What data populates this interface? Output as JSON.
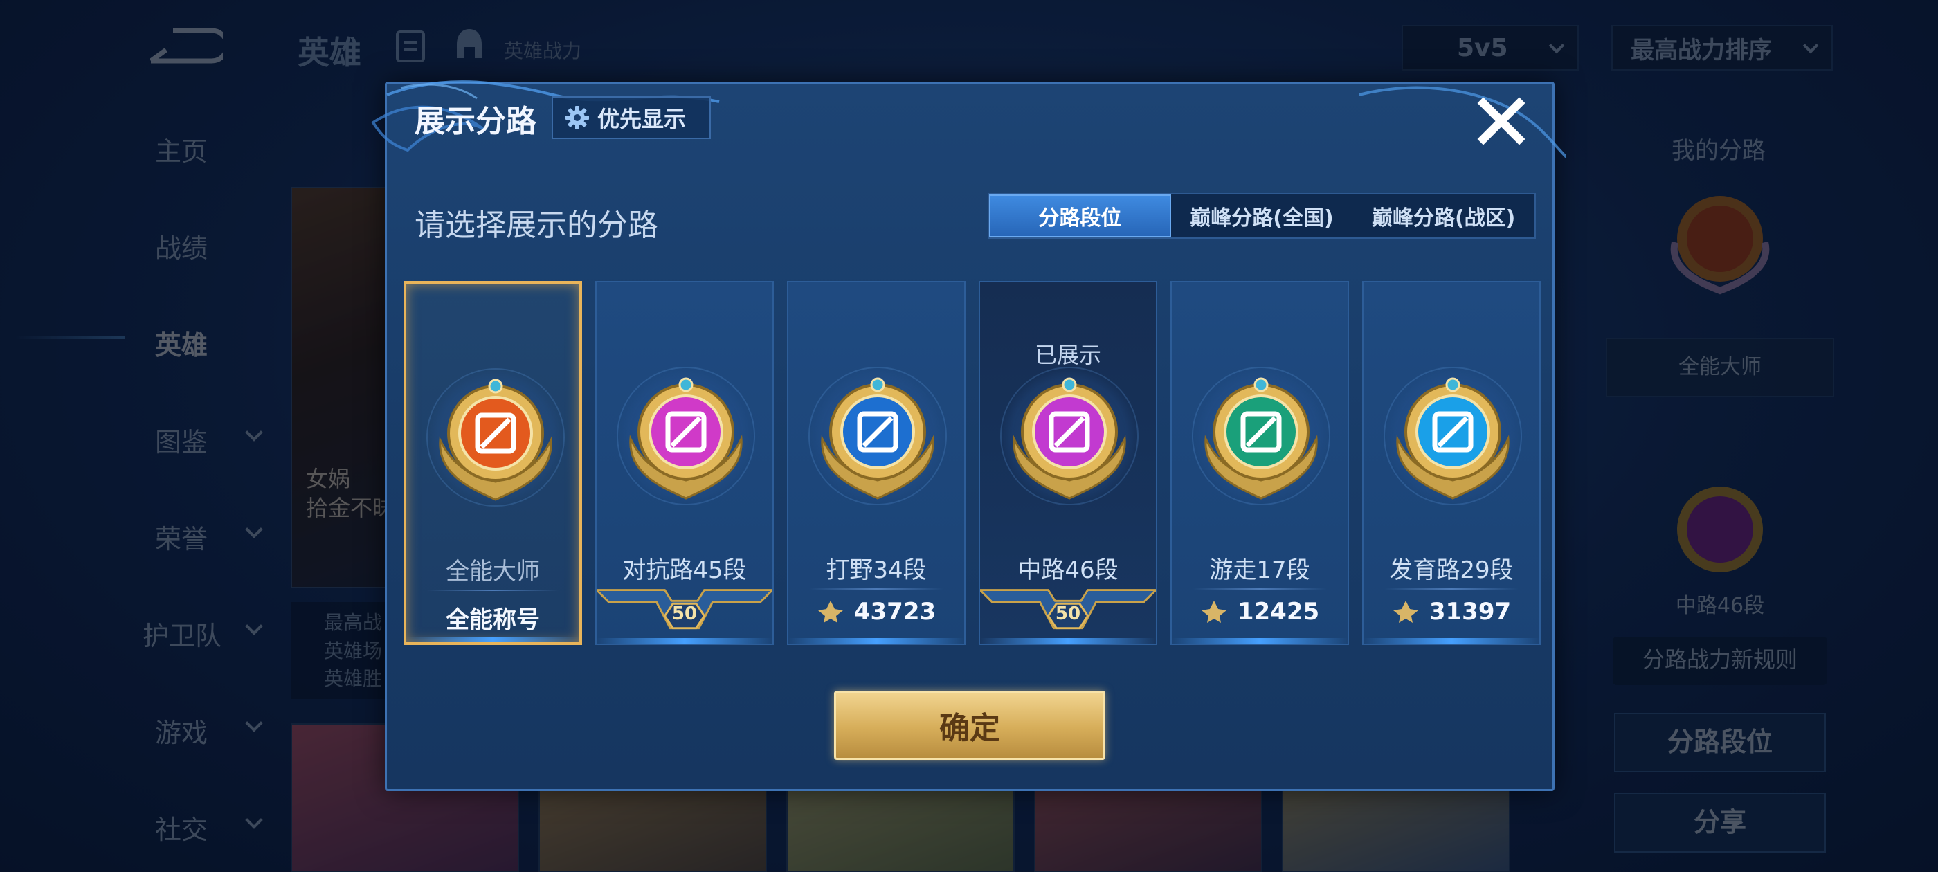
{
  "background": {
    "topbar": {
      "title": "英雄",
      "power_label": "英雄战力",
      "mode": "5v5",
      "sort": "最高战力排序"
    },
    "side_nav": [
      {
        "label": "主页",
        "has_arrow": false,
        "active": false
      },
      {
        "label": "战绩",
        "has_arrow": false,
        "active": false
      },
      {
        "label": "英雄",
        "has_arrow": false,
        "active": true
      },
      {
        "label": "图鉴",
        "has_arrow": true,
        "active": false
      },
      {
        "label": "荣誉",
        "has_arrow": true,
        "active": false
      },
      {
        "label": "护卫队",
        "has_arrow": true,
        "active": false
      },
      {
        "label": "游戏",
        "has_arrow": true,
        "active": false
      },
      {
        "label": "社交",
        "has_arrow": true,
        "active": false
      }
    ],
    "hero_card": {
      "name": "女娲",
      "subtitle": "拾金不昧",
      "info": [
        "最高战",
        "英雄场",
        "英雄胜"
      ]
    },
    "right_panel": {
      "title": "我的分路",
      "badge_name": "全能大师",
      "badge2_name": "中路46段",
      "note": "分路战力新规则",
      "btn_rank": "分路段位",
      "btn_share": "分享"
    }
  },
  "modal": {
    "title": "展示分路",
    "priority_label": "优先显示",
    "subtitle": "请选择展示的分路",
    "tabs": [
      "分路段位",
      "巅峰分路(全国)",
      "巅峰分路(战区)"
    ],
    "active_tab": 0,
    "cards": [
      {
        "name": "全能大师",
        "value": "全能称号",
        "kind": "title",
        "selected": true,
        "shown": false,
        "color": "#e35a1e"
      },
      {
        "name": "对抗路45段",
        "value": "50",
        "kind": "level",
        "selected": false,
        "shown": false,
        "color": "#d03ac8"
      },
      {
        "name": "打野34段",
        "value": "43723",
        "kind": "score",
        "selected": false,
        "shown": false,
        "color": "#1d6fd0"
      },
      {
        "name": "中路46段",
        "value": "50",
        "kind": "level",
        "selected": false,
        "shown": true,
        "shown_label": "已展示",
        "color": "#c23ad0"
      },
      {
        "name": "游走17段",
        "value": "12425",
        "kind": "score",
        "selected": false,
        "shown": false,
        "color": "#1aa07a"
      },
      {
        "name": "发育路29段",
        "value": "31397",
        "kind": "score",
        "selected": false,
        "shown": false,
        "color": "#1aa0e8"
      }
    ],
    "confirm_label": "确定"
  }
}
